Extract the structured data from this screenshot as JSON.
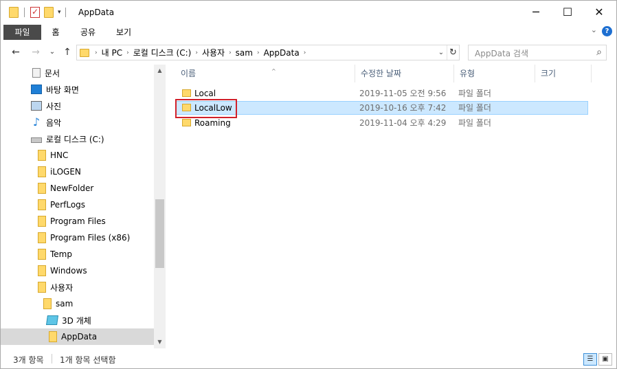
{
  "window": {
    "title": "AppData",
    "controls": {
      "minimize": "─",
      "maximize": "☐",
      "close": "✕"
    }
  },
  "ribbon": {
    "tabs": [
      "파일",
      "홈",
      "공유",
      "보기"
    ],
    "help": "?"
  },
  "nav": {
    "back": "←",
    "forward": "→",
    "recent": "⌄",
    "up": "↑",
    "breadcrumb": [
      "내 PC",
      "로컬 디스크 (C:)",
      "사용자",
      "sam",
      "AppData"
    ],
    "search_placeholder": "AppData 검색"
  },
  "sidebar": {
    "items": [
      {
        "label": "문서",
        "icon": "document-icon"
      },
      {
        "label": "바탕 화면",
        "icon": "desktop-icon"
      },
      {
        "label": "사진",
        "icon": "pictures-icon"
      },
      {
        "label": "음악",
        "icon": "music-icon"
      },
      {
        "label": "로컬 디스크 (C:)",
        "icon": "drive-icon"
      },
      {
        "label": "HNC",
        "icon": "folder-icon"
      },
      {
        "label": "iLOGEN",
        "icon": "folder-icon"
      },
      {
        "label": "NewFolder",
        "icon": "folder-icon"
      },
      {
        "label": "PerfLogs",
        "icon": "folder-icon"
      },
      {
        "label": "Program Files",
        "icon": "folder-icon"
      },
      {
        "label": "Program Files (x86)",
        "icon": "folder-icon"
      },
      {
        "label": "Temp",
        "icon": "folder-icon"
      },
      {
        "label": "Windows",
        "icon": "folder-icon"
      },
      {
        "label": "사용자",
        "icon": "folder-icon"
      },
      {
        "label": "sam",
        "icon": "folder-icon"
      },
      {
        "label": "3D 개체",
        "icon": "3d-objects-icon"
      },
      {
        "label": "AppData",
        "icon": "folder-icon",
        "selected": true
      }
    ]
  },
  "columns": [
    "이름",
    "수정한 날짜",
    "유형",
    "크기"
  ],
  "files": [
    {
      "name": "Local",
      "date": "2019-11-05 오전 9:56",
      "type": "파일 폴더",
      "size": ""
    },
    {
      "name": "LocalLow",
      "date": "2019-10-16 오후 7:42",
      "type": "파일 폴더",
      "size": "",
      "selected": true
    },
    {
      "name": "Roaming",
      "date": "2019-11-04 오후 4:29",
      "type": "파일 폴더",
      "size": ""
    }
  ],
  "status": {
    "count": "3개 항목",
    "selection": "1개 항목 선택함"
  },
  "colors": {
    "selection_bg": "#cce8ff",
    "selection_border": "#99d1ff",
    "highlight_box": "#d1202a",
    "file_tab_bg": "#4a4a4a"
  }
}
